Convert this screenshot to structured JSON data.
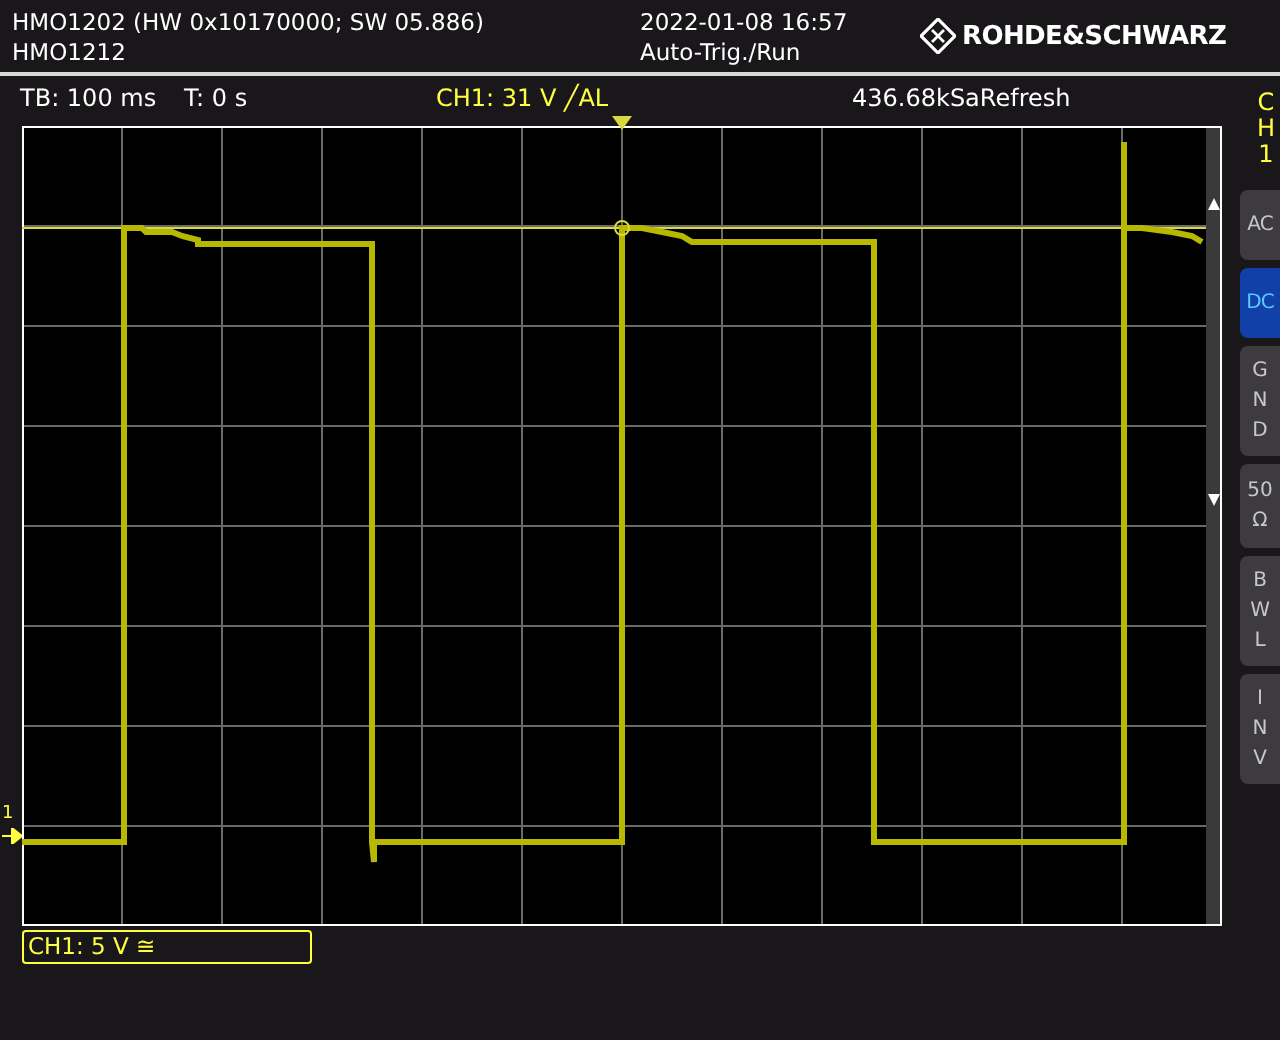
{
  "header": {
    "model": "HMO1202 (HW 0x10170000; SW 05.886)",
    "device": "HMO1212",
    "datetime": "2022-01-08 16:57",
    "run_status": "Auto-Trig./Run",
    "brand": "ROHDE&SCHWARZ"
  },
  "info_bar": {
    "timebase": "TB: 100 ms",
    "trigger_time": "T: 0 s",
    "trigger": "CH1: 31 V ╱AL",
    "acquisition": "436.68kSaRefresh"
  },
  "ground_marker": "1",
  "side_panel": {
    "channel": "CH1",
    "buttons": [
      {
        "label": "AC",
        "kind": "row",
        "selected": false
      },
      {
        "label": "DC",
        "kind": "row",
        "selected": true
      },
      {
        "label": "GND",
        "kind": "column",
        "selected": false
      },
      {
        "label": "50 Ω",
        "kind": "stacked",
        "selected": false
      },
      {
        "label": "BWL",
        "kind": "column",
        "selected": false
      },
      {
        "label": "INV",
        "kind": "column",
        "selected": false
      }
    ]
  },
  "channel_scale": "CH1: 5 V ≅"
}
